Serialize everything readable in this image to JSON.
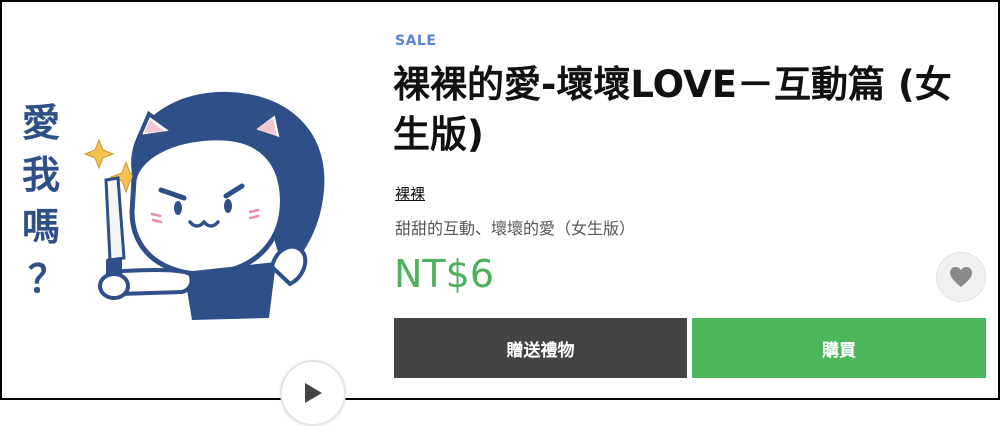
{
  "product": {
    "sale_badge": "SALE",
    "title": "裸裸的愛-壞壞LOVE－互動篇 (女生版)",
    "author": "裸裸",
    "description": "甜甜的互動、壞壞的愛（女生版）",
    "price": "NT$6"
  },
  "sticker": {
    "caption_chars": [
      "愛",
      "我",
      "嗎",
      "？"
    ]
  },
  "actions": {
    "gift_label": "贈送禮物",
    "buy_label": "購買"
  },
  "icons": {
    "play": "play-icon",
    "favorite": "heart-icon"
  },
  "colors": {
    "sale": "#5b82db",
    "price": "#4cb05c",
    "buy_button": "#4cb65a",
    "gift_button": "#444444",
    "hair": "#2e4f87"
  }
}
